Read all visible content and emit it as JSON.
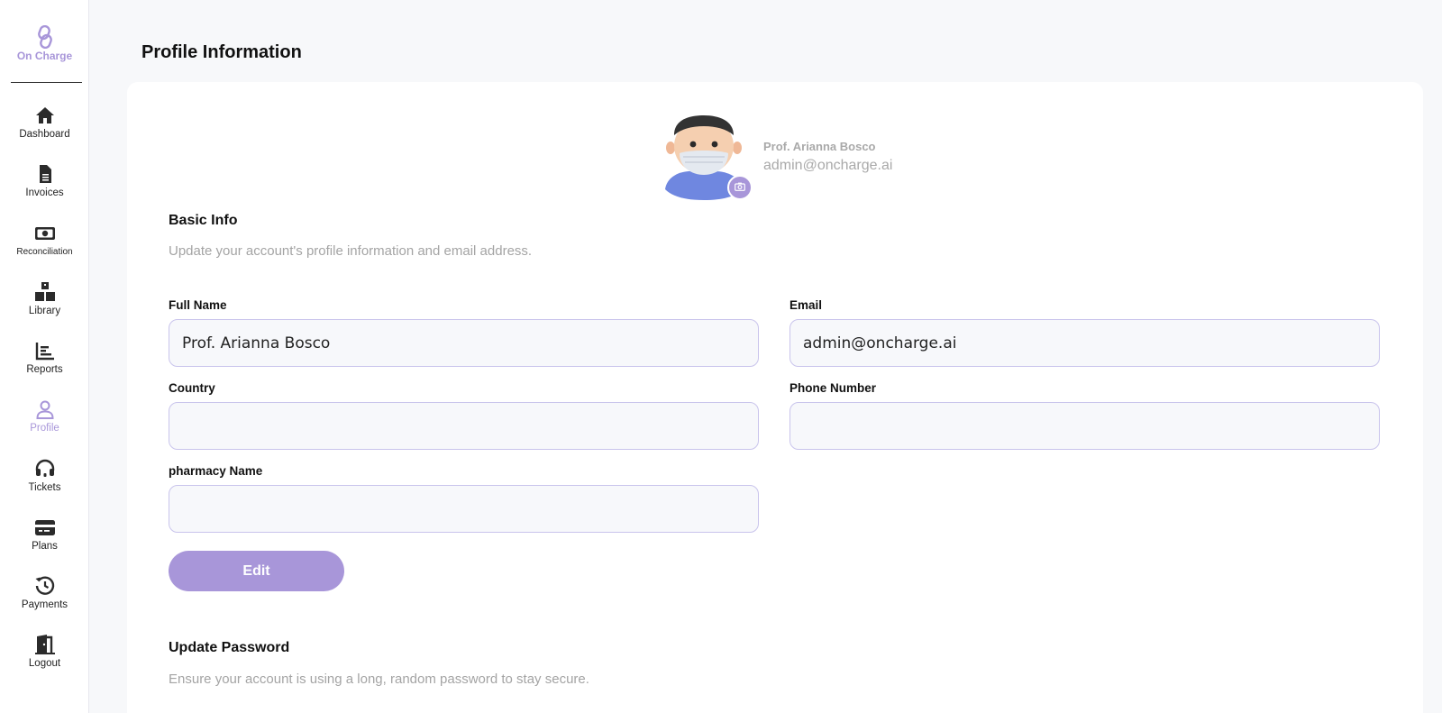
{
  "app": {
    "logo_text": "On Charge"
  },
  "sidebar": {
    "items": [
      {
        "label": "Dashboard",
        "icon": "home-icon"
      },
      {
        "label": "Invoices",
        "icon": "document-icon"
      },
      {
        "label": "Reconciliation",
        "icon": "money-icon"
      },
      {
        "label": "Library",
        "icon": "boxes-icon"
      },
      {
        "label": "Reports",
        "icon": "chart-icon"
      },
      {
        "label": "Profile",
        "icon": "user-icon",
        "active": true
      },
      {
        "label": "Tickets",
        "icon": "headset-icon"
      },
      {
        "label": "Plans",
        "icon": "credit-card-icon"
      },
      {
        "label": "Payments",
        "icon": "history-icon"
      },
      {
        "label": "Logout",
        "icon": "door-icon"
      }
    ]
  },
  "page": {
    "title": "Profile Information"
  },
  "profile": {
    "name": "Prof. Arianna Bosco",
    "email": "admin@oncharge.ai"
  },
  "basic_info": {
    "title": "Basic Info",
    "description": "Update your account's profile information and email address.",
    "full_name": {
      "label": "Full Name",
      "value": "Prof. Arianna Bosco"
    },
    "email": {
      "label": "Email",
      "value": "admin@oncharge.ai"
    },
    "country": {
      "label": "Country",
      "value": ""
    },
    "phone": {
      "label": "Phone Number",
      "value": ""
    },
    "pharmacy_name": {
      "label": "pharmacy Name",
      "value": ""
    },
    "edit_label": "Edit"
  },
  "update_password": {
    "title": "Update Password",
    "description": "Ensure your account is using a long, random password to stay secure."
  },
  "colors": {
    "accent": "#a896d9",
    "input_border": "#c9c4ec",
    "muted_text": "#a4a4a4"
  }
}
